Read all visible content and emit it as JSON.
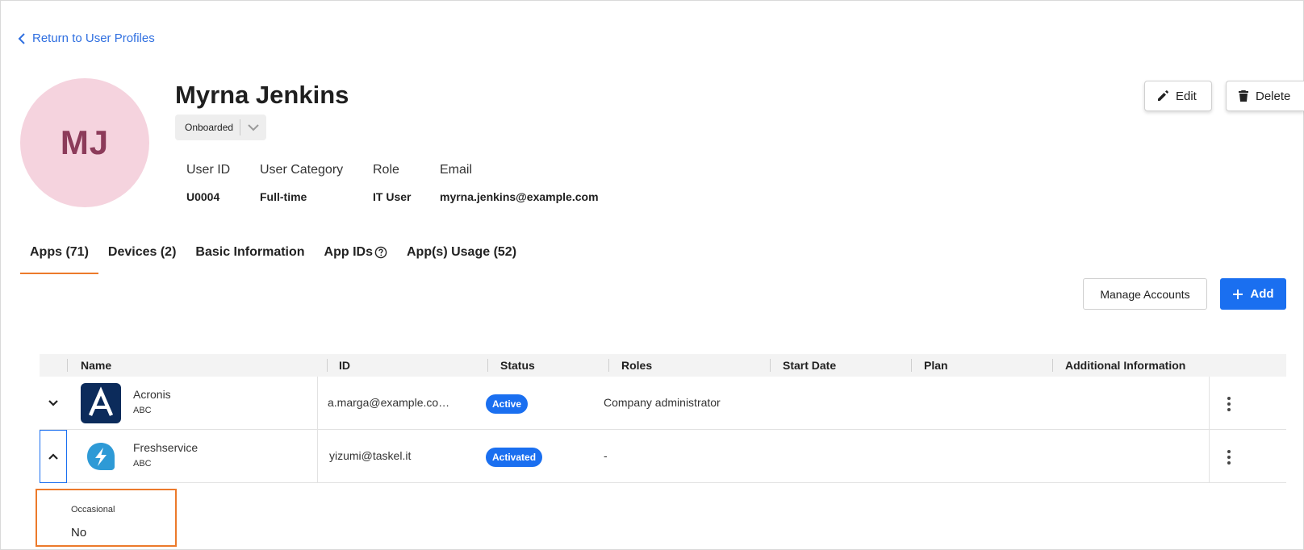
{
  "back_link": {
    "label": "Return to User Profiles"
  },
  "profile": {
    "initials": "MJ",
    "name": "Myrna Jenkins",
    "status": "Onboarded",
    "fields": [
      {
        "label": "User ID",
        "value": "U0004"
      },
      {
        "label": "User Category",
        "value": "Full-time"
      },
      {
        "label": "Role",
        "value": "IT User"
      },
      {
        "label": "Email",
        "value": "myrna.jenkins@example.com"
      }
    ]
  },
  "actions": {
    "edit": "Edit",
    "delete": "Delete"
  },
  "tabs": [
    {
      "label": "Apps (71)",
      "active": true
    },
    {
      "label": "Devices (2)"
    },
    {
      "label": "Basic Information"
    },
    {
      "label": "App IDs"
    },
    {
      "label": "App(s) Usage (52)"
    }
  ],
  "toolbar": {
    "manage_accounts": "Manage Accounts",
    "add": "Add"
  },
  "table": {
    "columns": [
      "Name",
      "ID",
      "Status",
      "Roles",
      "Start Date",
      "Plan",
      "Additional Information"
    ],
    "rows": [
      {
        "name": "Acronis",
        "sub": "ABC",
        "id": "a.marga@example.co…",
        "status": "Active",
        "roles": "Company administrator",
        "expanded": false
      },
      {
        "name": "Freshservice",
        "sub": "ABC",
        "id": "yizumi@taskel.it",
        "status": "Activated",
        "roles": "-",
        "expanded": true
      }
    ],
    "detail": {
      "label": "Occasional",
      "value": "No"
    }
  },
  "colors": {
    "accent_blue": "#1a6ff0",
    "tab_underline": "#ec7a2b",
    "avatar_bg": "#f5d3de",
    "avatar_text": "#8c3b5a"
  }
}
